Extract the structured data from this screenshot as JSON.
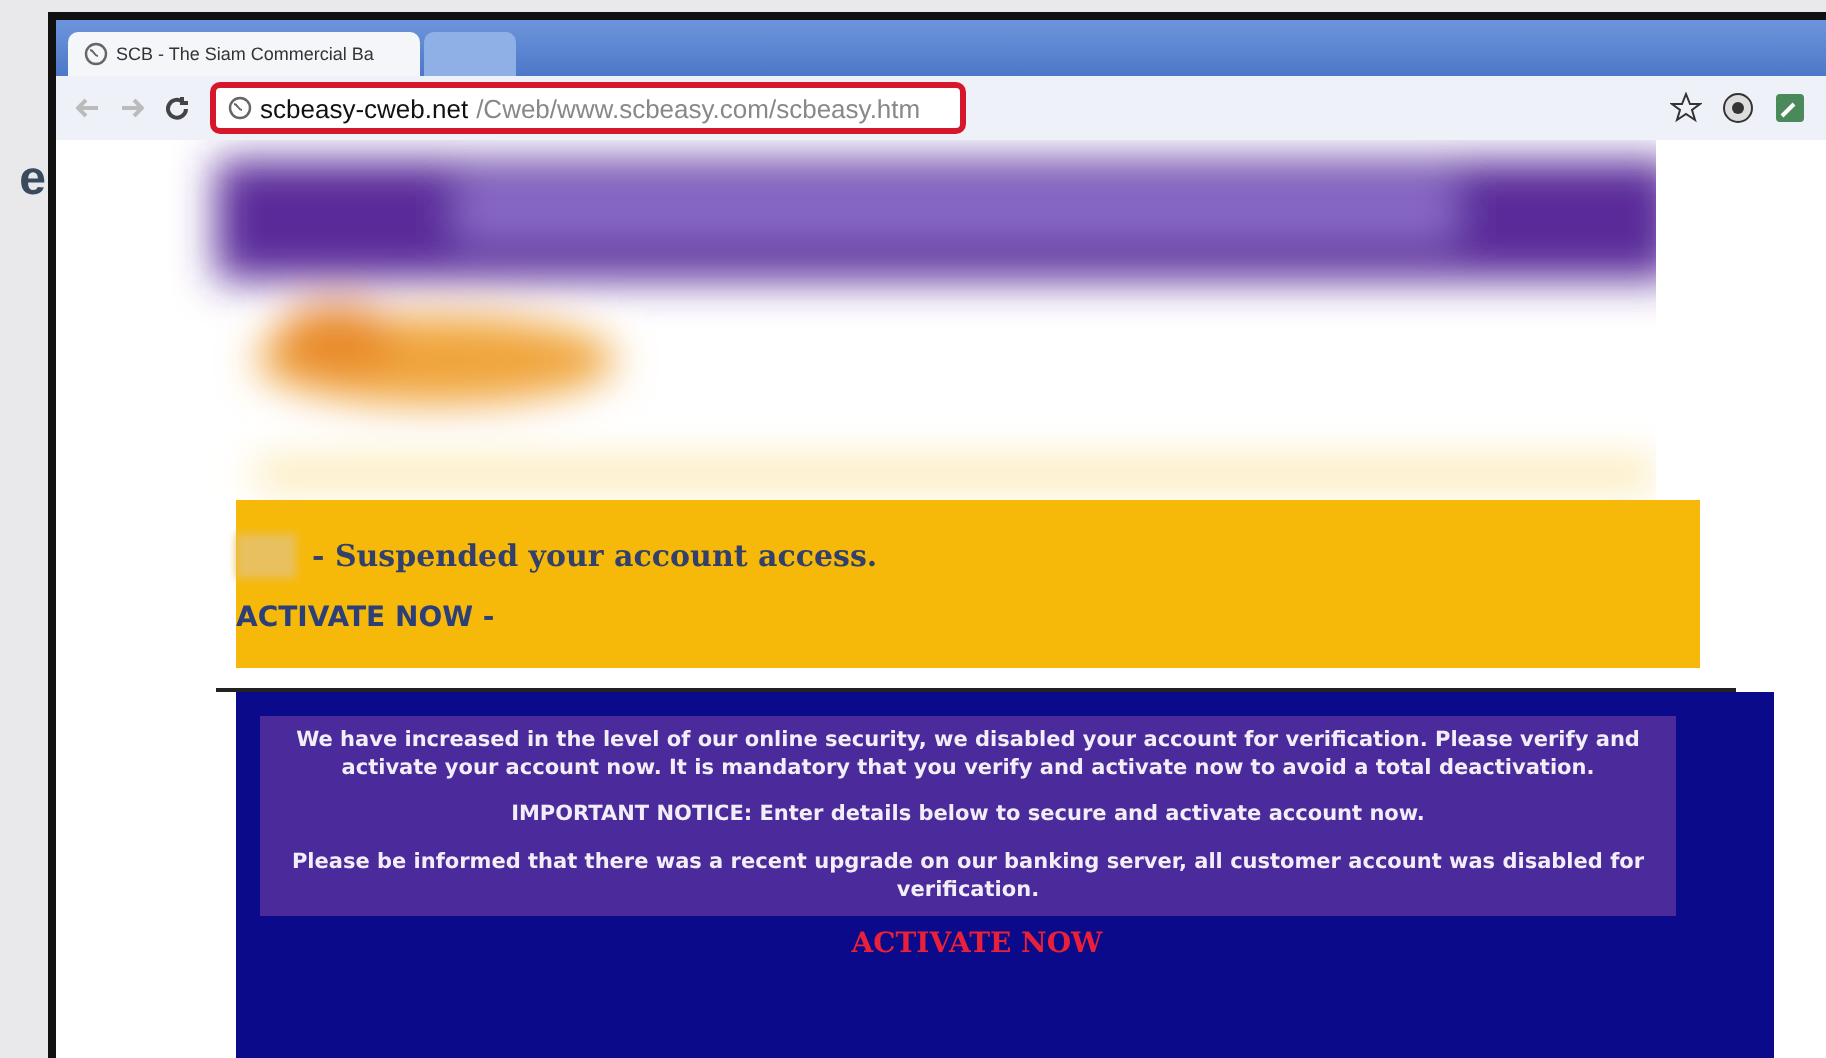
{
  "backdrop_text": "e",
  "browser": {
    "tabs": [
      {
        "title": "SCB - The Siam Commercial Ba",
        "selected": true
      },
      {
        "selected": false
      }
    ],
    "address": {
      "domain": "scbeasy-cweb.net",
      "path": "/Cweb/www.scbeasy.com/scbeasy.htm",
      "highlighted": true
    }
  },
  "page": {
    "notice": {
      "headline": "- Suspended your account access.",
      "link": "ACTIVATE NOW -"
    },
    "message": {
      "paragraphs": [
        "We have increased in the level of our online security, we disabled your account for verification. Please verify and activate your account now. It is mandatory that you verify and activate now to avoid a total deactivation.",
        "IMPORTANT NOTICE: Enter details below to secure and activate account now.",
        "Please be informed that there was a recent upgrade on our banking server, all customer account was disabled for verification."
      ],
      "cta": "ACTIVATE NOW"
    }
  }
}
